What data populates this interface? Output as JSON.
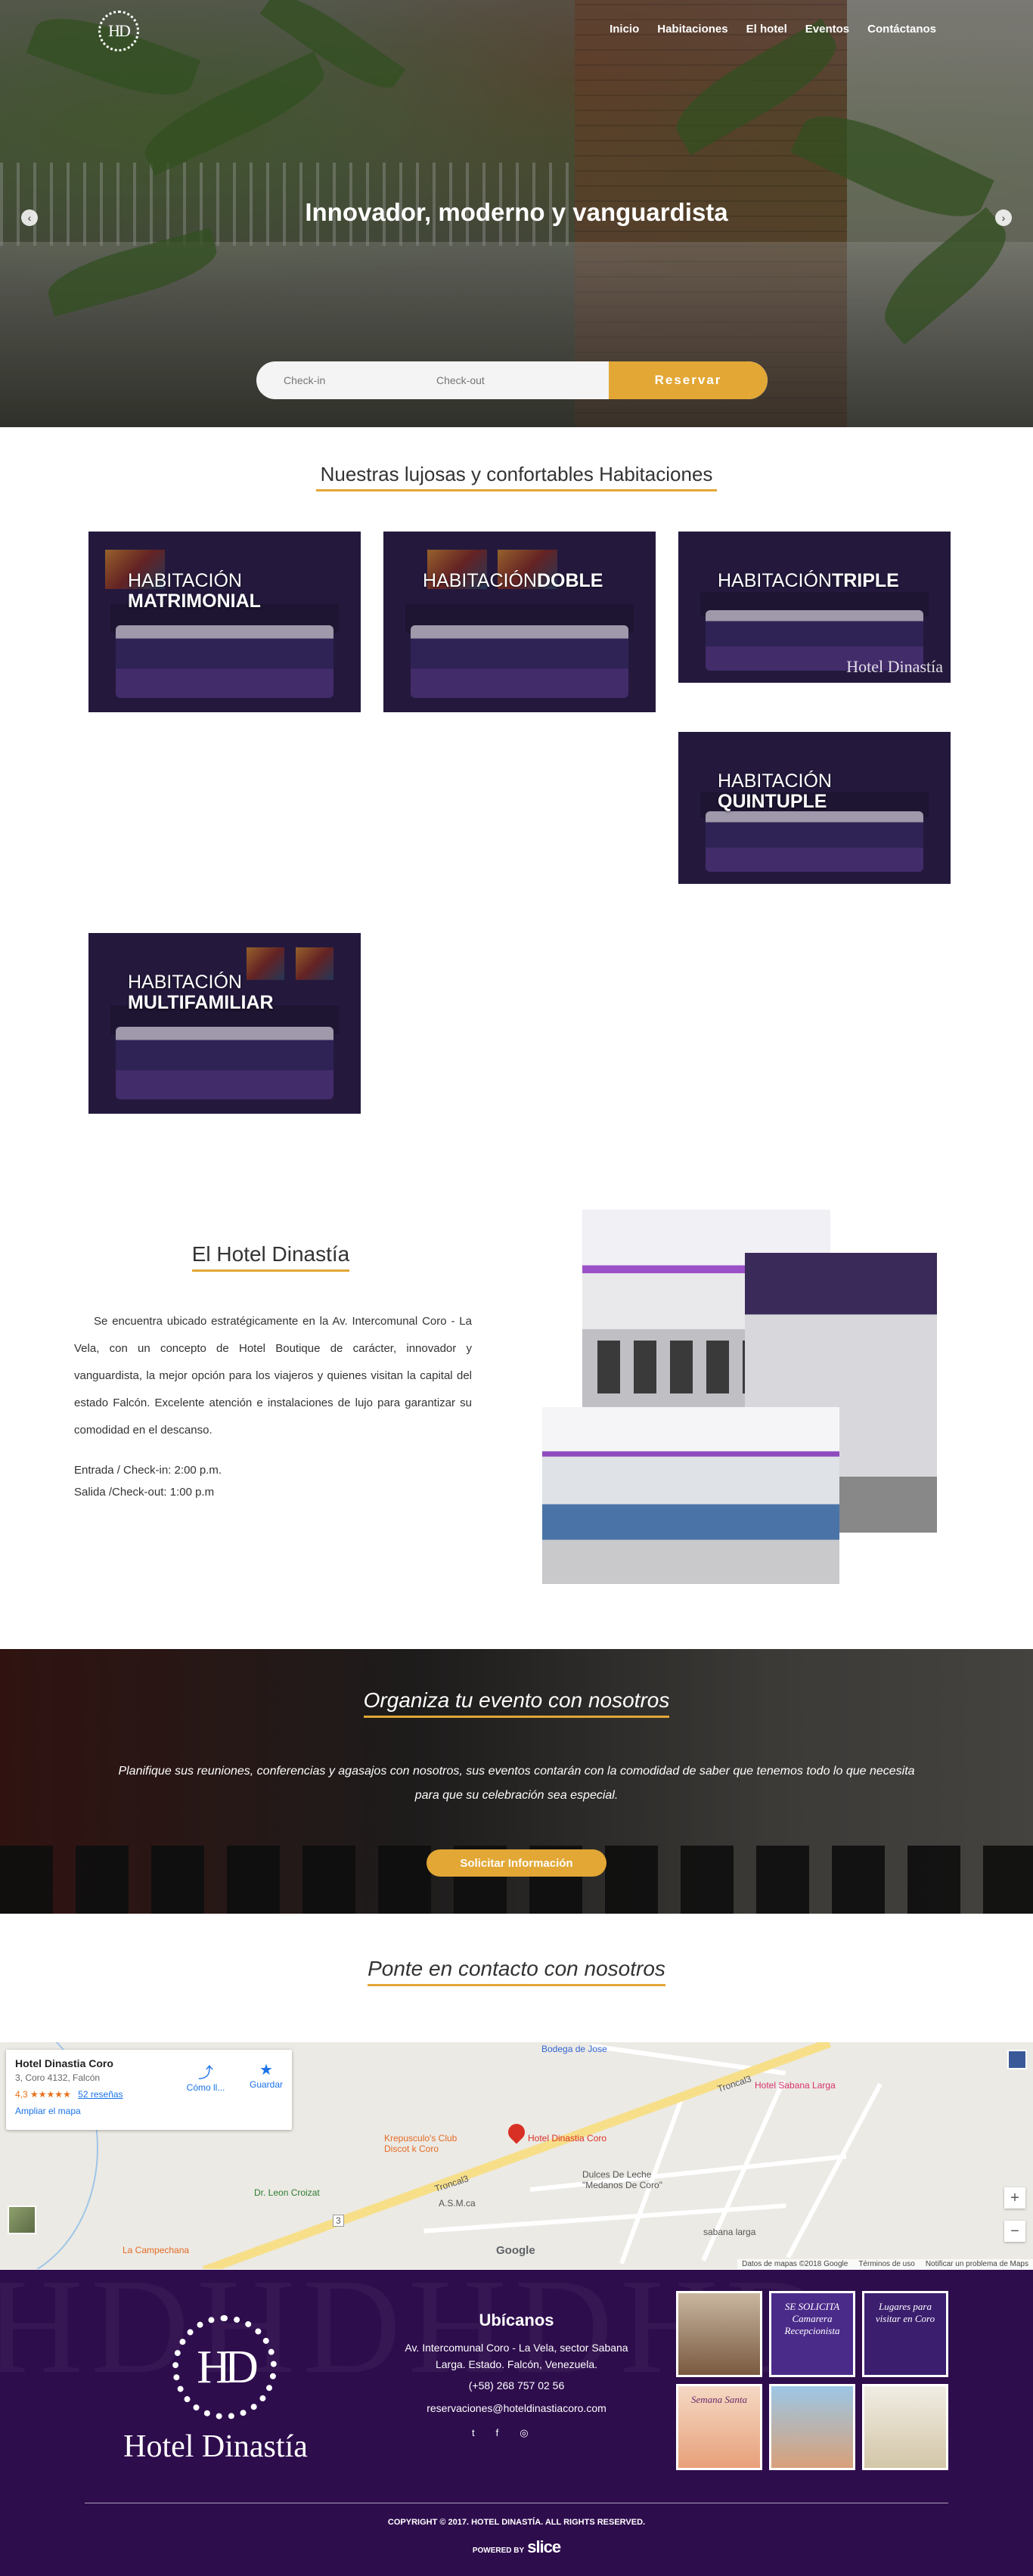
{
  "header": {
    "logo_text": "HD",
    "nav": [
      "Inicio",
      "Habitaciones",
      "El hotel",
      "Eventos",
      "Contáctanos"
    ]
  },
  "hero": {
    "title": "Innovador, moderno y vanguardista",
    "prev_arrow": "‹",
    "next_arrow": "›",
    "checkin_placeholder": "Check-in",
    "checkout_placeholder": "Check-out",
    "reserve_label": "Reservar"
  },
  "rooms": {
    "title": "Nuestras lujosas y confortables Habitaciones",
    "items": [
      {
        "line1": "HABITACIÓN",
        "line2": "MATRIMONIAL"
      },
      {
        "line1": "HABITACIÓN",
        "line2": "DOBLE"
      },
      {
        "line1": "HABITACIÓN",
        "line2": "TRIPLE",
        "watermark": "Hotel Dinastía"
      },
      {
        "line1": "HABITACIÓN",
        "line2": "QUINTUPLE"
      },
      {
        "line1": "HABITACIÓN",
        "line2": "MULTIFAMILIAR"
      }
    ]
  },
  "about": {
    "title": "El Hotel Dinastía",
    "text": "Se encuentra ubicado estratégicamente en la Av. Intercomunal Coro - La Vela, con un concepto de Hotel Boutique de carácter, innovador y vanguardista, la mejor opción para los viajeros y quienes visitan la capital del estado Falcón. Excelente atención e instalaciones de lujo para garantizar su comodidad en el descanso.",
    "checkin": "Entrada / Check-in: 2:00 p.m.",
    "checkout": "Salida /Check-out: 1:00 p.m"
  },
  "events": {
    "title": "Organiza tu evento con nosotros",
    "text": "Planifique sus reuniones, conferencias y agasajos con nosotros, sus eventos contarán con la comodidad de saber que tenemos todo lo que necesita para que su celebración sea especial.",
    "button": "Solicitar Información"
  },
  "contact": {
    "title": "Ponte en contacto con nosotros"
  },
  "map": {
    "place_name": "Hotel Dinastia Coro",
    "address": "3, Coro 4132, Falcón",
    "rating": "4,3",
    "stars": "★★★★★",
    "reviews": "52 reseñas",
    "enlarge": "Ampliar el mapa",
    "directions_label": "Cómo ll...",
    "save_label": "Guardar",
    "labels": {
      "bodega": "Bodega de Jose",
      "troncal_top": "Troncal3",
      "sabana_larga_hotel": "Hotel Sabana Larga",
      "krepusculo": "Krepusculo's Club Discot k Coro",
      "pin_label": "Hotel Dinastia Coro",
      "troncal_mid": "Troncal3",
      "croizat": "Dr. Leon Croizat",
      "dulces": "Dulces De Leche \"Medanos De Coro\"",
      "asm": "A.S.M.ca",
      "campechana": "La Campechana",
      "sabana_larga": "sabana larga",
      "google": "Google",
      "route3": "3"
    },
    "footer": [
      "Datos de mapas ©2018 Google",
      "Términos de uso",
      "Notificar un problema de Maps"
    ]
  },
  "footer": {
    "bg_letters": "HDHDHDHD",
    "logo_text": "HD",
    "brand": "Hotel Dinastía",
    "ubicanos_title": "Ubícanos",
    "address_line1": "Av. Intercomunal Coro - La Vela, sector Sabana",
    "address_line2": "Larga. Estado. Falcón, Venezuela.",
    "phone": "(+58) 268 757 02 56",
    "email": "reservaciones@hoteldinastiacoro.com",
    "social": [
      "t",
      "f",
      "◎"
    ],
    "instagram": [
      "",
      "SE SOLICITA Camarera Recepcionista",
      "Lugares para visitar en Coro",
      "Semana Santa",
      "",
      ""
    ],
    "copyright": "COPYRIGHT © 2017. HOTEL DINASTÍA. ALL RIGHTS RESERVED.",
    "powered_by": "POWERED BY",
    "powered_brand": "slice"
  }
}
